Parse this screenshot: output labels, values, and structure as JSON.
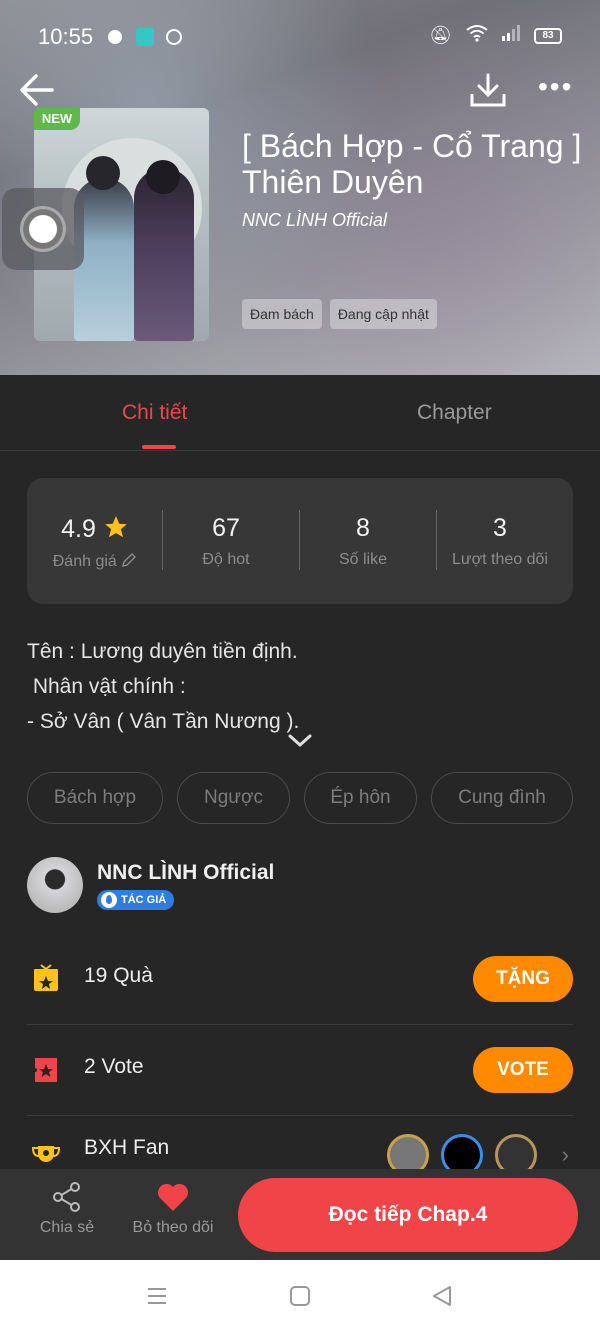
{
  "status_bar": {
    "time": "10:55",
    "battery": "83"
  },
  "book": {
    "badge": "NEW",
    "title": "[ Bách Hợp - Cổ Trang ] Thiên Duyên",
    "author_line": "NNC LÌNH Official",
    "tags": [
      "Đam bách",
      "Đang cập nhật"
    ]
  },
  "tabs": {
    "detail": "Chi tiết",
    "chapter": "Chapter"
  },
  "stats": [
    {
      "value": "4.9",
      "label": "Đánh giá"
    },
    {
      "value": "67",
      "label": "Độ hot"
    },
    {
      "value": "8",
      "label": "Số like"
    },
    {
      "value": "3",
      "label": "Lượt theo dõi"
    }
  ],
  "description": {
    "line1": "Tên : Lương duyên tiền định.",
    "line2": " Nhân vật chính :",
    "line3": "- Sở Vân ( Vân Tần Nương )."
  },
  "genres": [
    "Bách hợp",
    "Ngược",
    "Ép hôn",
    "Cung đình"
  ],
  "author": {
    "name": "NNC LÌNH Official",
    "badge": "TÁC GIẢ"
  },
  "gifts": {
    "label": "19 Quà",
    "button": "TẶNG"
  },
  "votes": {
    "label": "2 Vote",
    "button": "VOTE"
  },
  "fan_rank": {
    "label": "BXH Fan"
  },
  "bottom_bar": {
    "share": "Chia sẻ",
    "unfollow": "Bỏ theo dõi",
    "read": "Đọc tiếp Chap.4"
  },
  "colors": {
    "accent": "#f0464b",
    "orange": "#ff8a00",
    "bg": "#262626"
  }
}
